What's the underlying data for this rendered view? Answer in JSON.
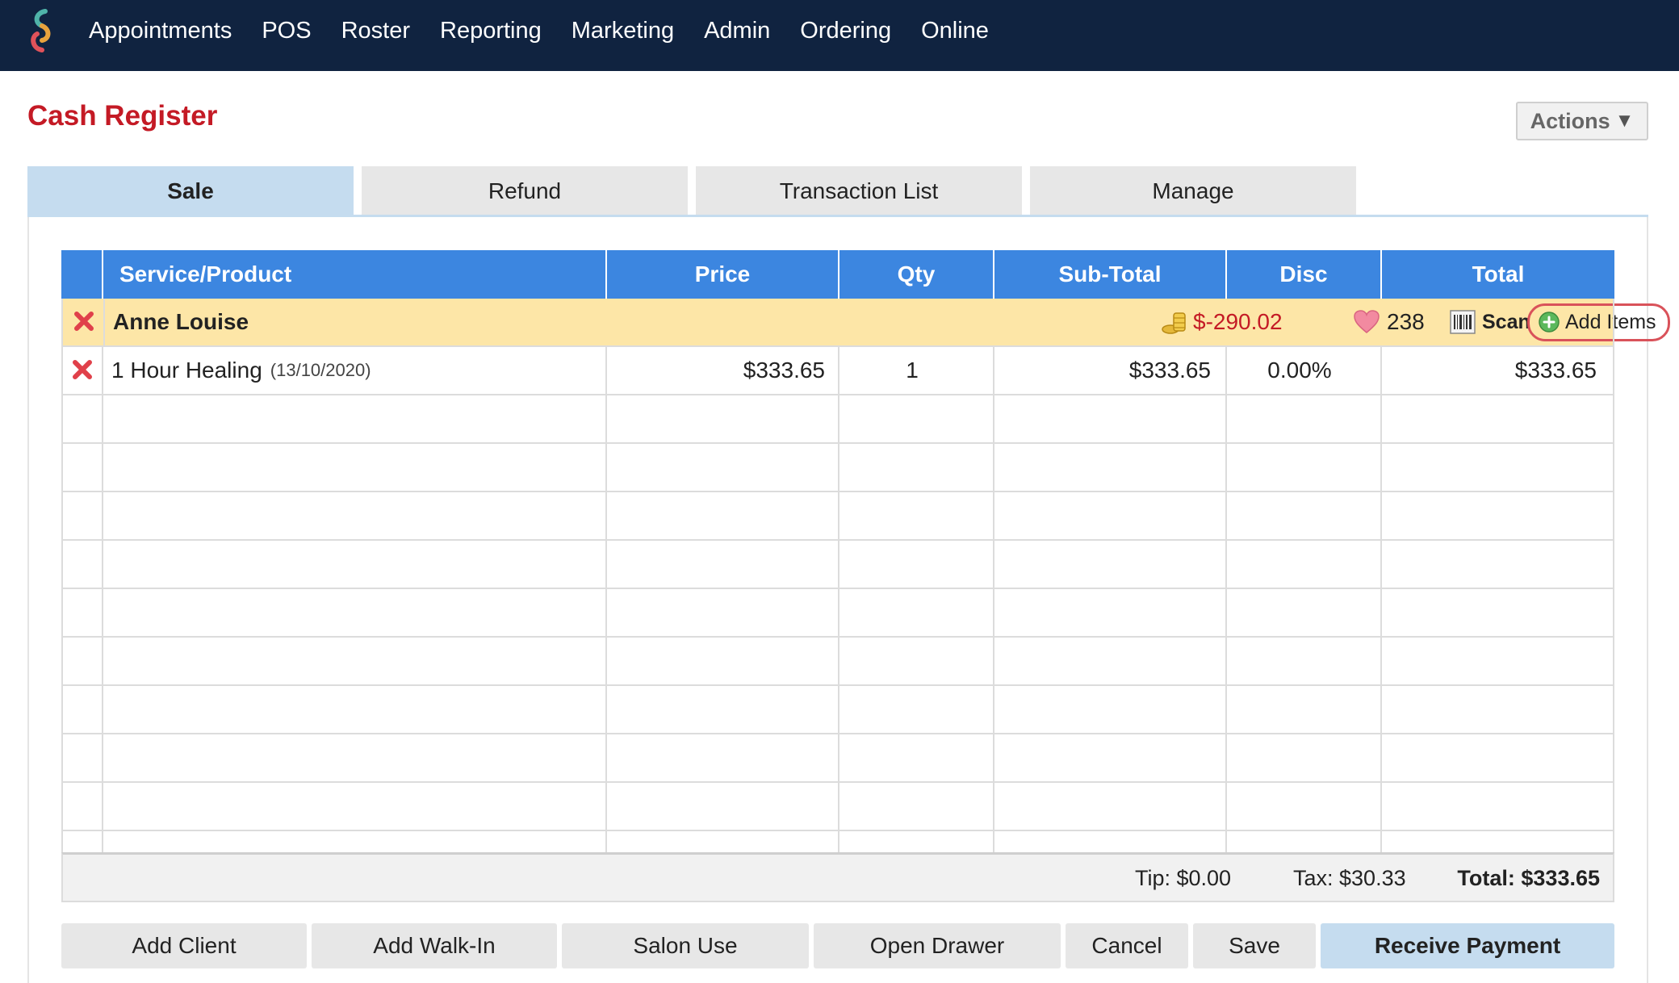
{
  "nav": {
    "items": [
      "Appointments",
      "POS",
      "Roster",
      "Reporting",
      "Marketing",
      "Admin",
      "Ordering",
      "Online"
    ]
  },
  "page": {
    "title": "Cash Register",
    "actions_label": "Actions"
  },
  "tabs": [
    "Sale",
    "Refund",
    "Transaction List",
    "Manage"
  ],
  "table": {
    "columns": [
      "Service/Product",
      "Price",
      "Qty",
      "Sub-Total",
      "Disc",
      "Total"
    ],
    "client": {
      "name": "Anne Louise",
      "balance": "$-290.02",
      "points": "238",
      "scan_label": "Scan",
      "add_items_label": "Add Items"
    },
    "items": [
      {
        "name": "1 Hour Healing",
        "date": "(13/10/2020)",
        "price": "$333.65",
        "qty": "1",
        "subtotal": "$333.65",
        "disc": "0.00%",
        "total": "$333.65"
      }
    ]
  },
  "totals": {
    "tip": "Tip: $0.00",
    "tax": "Tax: $30.33",
    "total": "Total: $333.65"
  },
  "buttons": [
    "Add Client",
    "Add Walk-In",
    "Salon Use",
    "Open Drawer",
    "Cancel",
    "Save",
    "Receive Payment"
  ],
  "colors": {
    "nav_bg": "#102340",
    "title": "#c41a25",
    "header_blue": "#3c86e0",
    "client_row": "#fde6a7",
    "active_tab": "#c5dcef",
    "balance_red": "#c41a25"
  }
}
